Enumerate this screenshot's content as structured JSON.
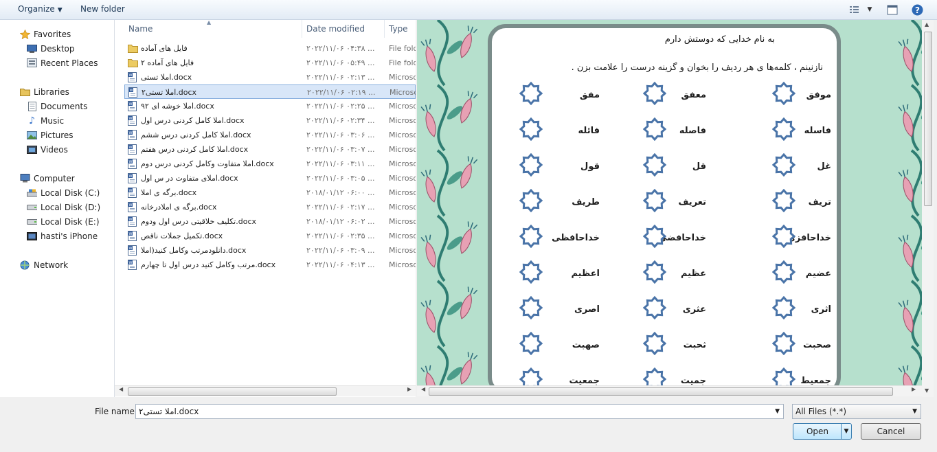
{
  "toolbar": {
    "organize": "Organize",
    "new_folder": "New folder"
  },
  "nav": {
    "favorites": "Favorites",
    "favorites_items": [
      "Desktop",
      "Recent Places"
    ],
    "libraries": "Libraries",
    "libraries_items": [
      "Documents",
      "Music",
      "Pictures",
      "Videos"
    ],
    "computer": "Computer",
    "computer_items": [
      "Local Disk (C:)",
      "Local Disk (D:)",
      "Local Disk (E:)",
      "hasti's iPhone"
    ],
    "network": "Network"
  },
  "columns": {
    "name": "Name",
    "date": "Date modified",
    "type": "Type"
  },
  "files": [
    {
      "name": "فایل های آماده",
      "date": "۲۰۲۲/۱۱/۰۶ ۰۴:۳۸ ...",
      "type": "File folder",
      "icon": "folder-icon"
    },
    {
      "name": "فایل های آماده ۲",
      "date": "۲۰۲۲/۱۱/۰۶ ۰۵:۴۹ ...",
      "type": "File folder",
      "icon": "folder-icon"
    },
    {
      "name": "املا تستی.docx",
      "date": "۲۰۲۲/۱۱/۰۶ ۰۲:۱۳ ...",
      "type": "Microsoft",
      "icon": "word-doc-icon"
    },
    {
      "name": "املا تستی۲.docx",
      "date": "۲۰۲۲/۱۱/۰۶ ۰۲:۱۹ ...",
      "type": "Microsoft",
      "icon": "word-doc-icon"
    },
    {
      "name": "املا خوشه ای ۹۲.docx",
      "date": "۲۰۲۲/۱۱/۰۶ ۰۲:۲۵ ...",
      "type": "Microsoft",
      "icon": "word-doc-icon"
    },
    {
      "name": "املا کامل کردنی درس اول.docx",
      "date": "۲۰۲۲/۱۱/۰۶ ۰۲:۳۴ ...",
      "type": "Microsoft",
      "icon": "word-doc-icon"
    },
    {
      "name": "املا کامل کردنی درس ششم.docx",
      "date": "۲۰۲۲/۱۱/۰۶ ۰۳:۰۶ ...",
      "type": "Microsoft",
      "icon": "word-doc-icon"
    },
    {
      "name": "املا کامل کردنی درس هفتم.docx",
      "date": "۲۰۲۲/۱۱/۰۶ ۰۳:۰۷ ...",
      "type": "Microsoft",
      "icon": "word-doc-icon"
    },
    {
      "name": "املا متفاوت وکامل کردنی درس دوم.docx",
      "date": "۲۰۲۲/۱۱/۰۶ ۰۳:۱۱ ...",
      "type": "Microsoft",
      "icon": "word-doc-icon"
    },
    {
      "name": "املای متفاوت در س اول.docx",
      "date": "۲۰۲۲/۱۱/۰۶ ۰۳:۰۵ ...",
      "type": "Microsoft",
      "icon": "word-doc-icon"
    },
    {
      "name": "برگه ی املا.docx",
      "date": "۲۰۱۸/۰۱/۱۲ ۰۶:۰۰ ...",
      "type": "Microsoft",
      "icon": "word-doc-icon"
    },
    {
      "name": "برگه ی املادرخانه.docx",
      "date": "۲۰۲۲/۱۱/۰۶ ۰۲:۱۷ ...",
      "type": "Microsoft",
      "icon": "word-doc-icon"
    },
    {
      "name": "تکلیف خلاقیتی درس اول ودوم.docx",
      "date": "۲۰۱۸/۰۱/۱۲ ۰۶:۰۲ ...",
      "type": "Microsoft",
      "icon": "word-doc-icon"
    },
    {
      "name": "تکمیل جملات ناقص.docx",
      "date": "۲۰۲۲/۱۱/۰۶ ۰۲:۳۵ ...",
      "type": "Microsoft",
      "icon": "word-doc-icon"
    },
    {
      "name": "دانلودمرتب وکامل کنید(املا.docx",
      "date": "۲۰۲۲/۱۱/۰۶ ۰۳:۰۹ ...",
      "type": "Microsoft",
      "icon": "word-doc-icon"
    },
    {
      "name": "مرتب وکامل کنید درس اول تا چهارم.docx",
      "date": "۲۰۲۲/۱۱/۰۶ ۰۴:۱۳ ...",
      "type": "Microsoft",
      "icon": "word-doc-icon"
    }
  ],
  "selected_index": 3,
  "preview": {
    "heading": "به نام خدایی که دوستش دارم",
    "instruction": "نازنینم ، کلمه‌ها ی هر ردیف را بخوان و گزینه درست را علامت بزن .",
    "rows": [
      [
        "موفق",
        "معفق",
        "مفق"
      ],
      [
        "فاسله",
        "فاصله",
        "فائله"
      ],
      [
        "غل",
        "قل",
        "قول"
      ],
      [
        "تریف",
        "تعریف",
        "طریف"
      ],
      [
        "خداحافزی",
        "خداحافضی",
        "خداحافظی"
      ],
      [
        "عضیم",
        "عظیم",
        "اعظیم"
      ],
      [
        "اثری",
        "عثری",
        "اصری"
      ],
      [
        "صحبت",
        "ثحبت",
        "صهبت"
      ],
      [
        "جمعیط",
        "جمیت",
        "جمعیت"
      ]
    ]
  },
  "bottom": {
    "filename_label": "File name:",
    "filename_value": "املا تستی۲.docx",
    "filter_value": "All Files (*.*)",
    "open_label": "Open",
    "cancel_label": "Cancel"
  },
  "colors": {
    "accent": "#3399ff",
    "preview_bg": "#b6e0cd",
    "star": "#4a74a8"
  }
}
